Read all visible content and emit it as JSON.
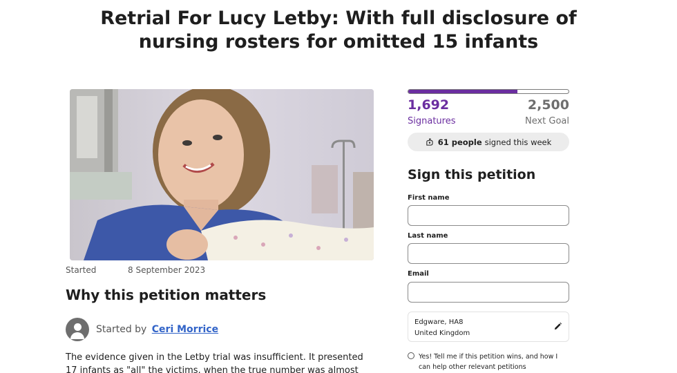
{
  "petition": {
    "title": "Retrial For Lucy Letby: With full disclosure of nursing rosters for omitted 15 infants",
    "started_label": "Started",
    "started_date": "8 September 2023",
    "why_heading": "Why this petition matters",
    "started_by_label": "Started by",
    "starter_name": "Ceri Morrice",
    "body_text": "The evidence given in the Letby trial was insufficient. It presented 17 infants as \"all\" the victims, when the true number was almost double that."
  },
  "progress": {
    "signatures": "1,692",
    "signatures_label": "Signatures",
    "goal": "2,500",
    "goal_label": "Next Goal",
    "fill_fraction": 0.68
  },
  "weekly": {
    "count": "61 people",
    "suffix": "signed this week",
    "icon": "hand-heart-icon"
  },
  "sign_form": {
    "heading": "Sign this petition",
    "first_name_label": "First name",
    "last_name_label": "Last name",
    "email_label": "Email",
    "first_name_value": "",
    "last_name_value": "",
    "email_value": "",
    "location_line1": "Edgware, HA8",
    "location_line2": "United Kingdom",
    "edit_icon": "pencil-icon",
    "optin_text": "Yes! Tell me if this petition wins, and how I can help other relevant petitions"
  },
  "colors": {
    "accent": "#6b2ea0",
    "link": "#3264c8",
    "muted": "#6e6e6e"
  }
}
